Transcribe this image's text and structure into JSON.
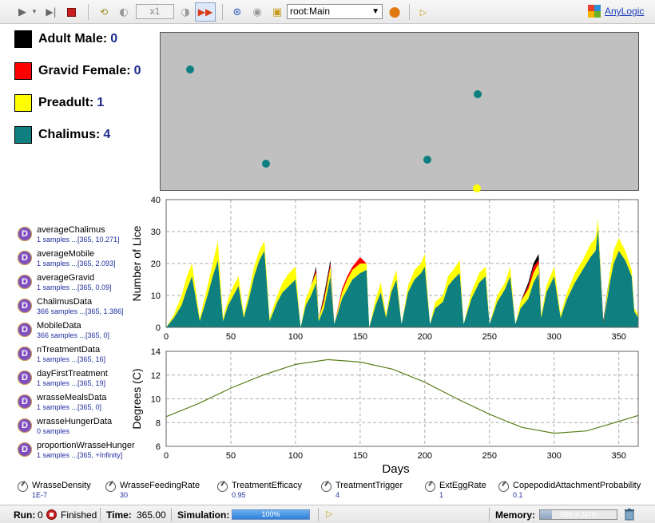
{
  "toolbar": {
    "speed": "x1",
    "experiment": "root:Main",
    "brand": "AnyLogic"
  },
  "legend": [
    {
      "label": "Adult Male:",
      "count": "0",
      "color": "#000000"
    },
    {
      "label": "Gravid Female:",
      "count": "0",
      "color": "#ff0000"
    },
    {
      "label": "Preadult:",
      "count": "1",
      "color": "#ffff00"
    },
    {
      "label": "Chalimus:",
      "count": "4",
      "color": "#0f7f7f"
    }
  ],
  "canvas": {
    "background": "#c0c0c0",
    "agents": [
      {
        "kind": "chalimus",
        "color": "#0f7f7f"
      },
      {
        "kind": "chalimus",
        "color": "#0f7f7f"
      },
      {
        "kind": "chalimus",
        "color": "#0f7f7f"
      },
      {
        "kind": "chalimus",
        "color": "#0f7f7f"
      },
      {
        "kind": "preadult",
        "color": "#ffff00"
      }
    ]
  },
  "datasets": [
    {
      "name": "averageChalimus",
      "sub": "1 samples ...[365, 10.271]"
    },
    {
      "name": "averageMobile",
      "sub": "1 samples ...[365, 2.093]"
    },
    {
      "name": "averageGravid",
      "sub": "1 samples ...[365, 0.09]"
    },
    {
      "name": "ChalimusData",
      "sub": "366 samples ...[365, 1.386]"
    },
    {
      "name": "MobileData",
      "sub": "366 samples ...[365, 0]"
    },
    {
      "name": "nTreatmentData",
      "sub": "1 samples ...[365, 16]"
    },
    {
      "name": "dayFirstTreatment",
      "sub": "1 samples ...[365, 19]"
    },
    {
      "name": "wrasseMealsData",
      "sub": "1 samples ...[365, 0]"
    },
    {
      "name": "wrasseHungerData",
      "sub": "0 samples"
    },
    {
      "name": "proportionWrasseHunger",
      "sub": "1 samples ...[365, +Infinity]"
    }
  ],
  "dataset_icon_letter": "D",
  "chart_data": [
    {
      "type": "area",
      "title": "",
      "xlabel": "",
      "ylabel": "Number of Lice",
      "xlim": [
        0,
        365
      ],
      "ylim": [
        0,
        40
      ],
      "xticks": [
        "0",
        "50",
        "100",
        "150",
        "200",
        "250",
        "300",
        "350"
      ],
      "yticks": [
        "0",
        "10",
        "20",
        "30",
        "40"
      ],
      "grid": true,
      "stacked": true,
      "series": [
        {
          "color": "#0f7f7f",
          "x": [
            0,
            6,
            12,
            16,
            20,
            26,
            32,
            36,
            40,
            44,
            48,
            52,
            56,
            60,
            64,
            68,
            72,
            76,
            80,
            86,
            90,
            95,
            100,
            104,
            108,
            112,
            116,
            118,
            122,
            127,
            130,
            136,
            140,
            144,
            150,
            155,
            157,
            162,
            166,
            170,
            174,
            178,
            182,
            187,
            192,
            197,
            200,
            204,
            208,
            214,
            218,
            222,
            227,
            230,
            236,
            242,
            247,
            250,
            256,
            262,
            266,
            270,
            274,
            280,
            284,
            288,
            290,
            294,
            300,
            305,
            310,
            316,
            322,
            328,
            332,
            334,
            338,
            343,
            346,
            350,
            355,
            360,
            362,
            365
          ],
          "values": [
            0,
            3,
            7,
            12,
            16,
            2,
            10,
            16,
            21,
            2,
            7,
            10,
            13,
            3,
            9,
            16,
            21,
            24,
            2,
            8,
            11,
            13,
            15,
            0,
            7,
            10,
            14,
            2,
            6,
            16,
            1,
            9,
            12,
            15,
            17,
            18,
            0,
            7,
            11,
            3,
            11,
            15,
            1,
            11,
            15,
            17,
            19,
            1,
            6,
            8,
            13,
            15,
            17,
            1,
            9,
            14,
            16,
            1,
            8,
            12,
            16,
            1,
            6,
            9,
            14,
            17,
            3,
            11,
            16,
            3,
            9,
            14,
            18,
            22,
            24,
            31,
            1,
            14,
            20,
            24,
            21,
            16,
            5,
            3
          ]
        },
        {
          "color": "#ffff00",
          "x": [
            0,
            6,
            12,
            16,
            20,
            26,
            32,
            36,
            40,
            44,
            48,
            52,
            56,
            60,
            64,
            68,
            72,
            76,
            80,
            86,
            90,
            95,
            100,
            104,
            108,
            112,
            116,
            118,
            122,
            127,
            130,
            136,
            140,
            144,
            150,
            155,
            157,
            162,
            166,
            170,
            174,
            178,
            182,
            187,
            192,
            197,
            200,
            204,
            208,
            214,
            218,
            222,
            227,
            230,
            236,
            242,
            247,
            250,
            256,
            262,
            266,
            270,
            274,
            280,
            284,
            288,
            290,
            294,
            300,
            305,
            310,
            316,
            322,
            328,
            332,
            334,
            338,
            343,
            346,
            350,
            355,
            360,
            362,
            365
          ],
          "values": [
            0,
            1,
            3,
            4,
            4,
            1,
            3,
            4,
            6,
            1,
            2,
            3,
            3,
            1,
            2,
            3,
            3,
            3,
            1,
            2,
            3,
            4,
            4,
            0,
            2,
            3,
            3,
            1,
            2,
            3,
            0,
            2,
            3,
            3,
            3,
            2,
            0,
            2,
            3,
            1,
            2,
            3,
            0,
            2,
            3,
            3,
            4,
            0,
            2,
            2,
            3,
            3,
            4,
            0,
            2,
            3,
            3,
            0,
            2,
            2,
            3,
            0,
            2,
            3,
            3,
            3,
            1,
            2,
            3,
            1,
            2,
            3,
            3,
            4,
            4,
            3,
            0,
            3,
            4,
            4,
            3,
            2,
            1,
            1
          ]
        },
        {
          "color": "#ff0000",
          "x": [
            0,
            6,
            12,
            16,
            20,
            26,
            32,
            36,
            40,
            44,
            48,
            52,
            56,
            60,
            64,
            68,
            72,
            76,
            80,
            86,
            90,
            95,
            100,
            104,
            108,
            112,
            116,
            118,
            122,
            127,
            130,
            136,
            140,
            144,
            150,
            155,
            157,
            162,
            166,
            170,
            174,
            178,
            182,
            187,
            192,
            197,
            200,
            204,
            208,
            214,
            218,
            222,
            227,
            230,
            236,
            242,
            247,
            250,
            256,
            262,
            266,
            270,
            274,
            280,
            284,
            288,
            290,
            294,
            300,
            305,
            310,
            316,
            322,
            328,
            332,
            334,
            338,
            343,
            346,
            350,
            355,
            360,
            362,
            365
          ],
          "values": [
            0,
            0,
            0,
            0,
            0,
            0,
            0,
            0,
            0,
            0,
            0,
            0,
            0,
            0,
            0,
            0,
            0,
            0,
            0,
            0,
            0,
            0,
            0,
            0,
            0,
            0,
            1,
            0,
            1,
            1,
            0,
            1,
            1,
            1,
            2,
            0,
            0,
            0,
            0,
            0,
            0,
            0,
            0,
            0,
            0,
            0,
            0,
            0,
            0,
            0,
            0,
            0,
            0,
            0,
            0,
            0,
            0,
            0,
            0,
            0,
            0,
            0,
            0,
            1,
            2,
            1,
            0,
            0,
            0,
            0,
            0,
            0,
            0,
            0,
            0,
            0,
            0,
            0,
            0,
            0,
            0,
            0,
            0,
            0
          ]
        },
        {
          "color": "#000000",
          "x": [
            0,
            6,
            12,
            16,
            20,
            26,
            32,
            36,
            40,
            44,
            48,
            52,
            56,
            60,
            64,
            68,
            72,
            76,
            80,
            86,
            90,
            95,
            100,
            104,
            108,
            112,
            116,
            118,
            122,
            127,
            130,
            136,
            140,
            144,
            150,
            155,
            157,
            162,
            166,
            170,
            174,
            178,
            182,
            187,
            192,
            197,
            200,
            204,
            208,
            214,
            218,
            222,
            227,
            230,
            236,
            242,
            247,
            250,
            256,
            262,
            266,
            270,
            274,
            280,
            284,
            288,
            290,
            294,
            300,
            305,
            310,
            316,
            322,
            328,
            332,
            334,
            338,
            343,
            346,
            350,
            355,
            360,
            362,
            365
          ],
          "values": [
            0,
            0,
            0,
            0,
            0,
            0,
            0,
            0,
            0,
            0,
            0,
            0,
            0,
            0,
            0,
            0,
            0,
            0,
            0,
            0,
            0,
            0,
            0,
            0,
            0,
            0,
            1,
            0,
            1,
            1,
            0,
            0,
            0,
            0,
            0,
            0,
            0,
            0,
            0,
            0,
            0,
            0,
            0,
            0,
            0,
            0,
            0,
            0,
            0,
            0,
            0,
            0,
            0,
            0,
            0,
            0,
            0,
            0,
            0,
            0,
            0,
            0,
            0,
            1,
            1,
            2,
            0,
            0,
            0,
            0,
            0,
            0,
            0,
            0,
            0,
            0,
            1,
            0,
            0,
            0,
            0,
            0,
            0,
            0
          ]
        }
      ]
    },
    {
      "type": "line",
      "title": "",
      "xlabel": "Days",
      "ylabel": "Degrees (C)",
      "xlim": [
        0,
        365
      ],
      "ylim": [
        6,
        14
      ],
      "xticks": [
        "0",
        "50",
        "100",
        "150",
        "200",
        "250",
        "300",
        "350"
      ],
      "yticks": [
        "6",
        "8",
        "10",
        "12",
        "14"
      ],
      "grid": true,
      "series": [
        {
          "color": "#5a7f1a",
          "x": [
            0,
            25,
            50,
            75,
            100,
            125,
            150,
            175,
            200,
            225,
            250,
            275,
            300,
            325,
            350,
            365
          ],
          "values": [
            8.5,
            9.6,
            10.9,
            12.0,
            12.9,
            13.3,
            13.1,
            12.5,
            11.4,
            10.0,
            8.7,
            7.6,
            7.1,
            7.3,
            8.1,
            8.6
          ]
        }
      ]
    }
  ],
  "params": [
    {
      "name": "WrasseDensity",
      "value": "1E-7"
    },
    {
      "name": "WrasseFeedingRate",
      "value": "30"
    },
    {
      "name": "TreatmentEfficacy",
      "value": "0.95"
    },
    {
      "name": "TreatmentTrigger",
      "value": "4"
    },
    {
      "name": "ExtEggRate",
      "value": "1"
    },
    {
      "name": "CopepodidAttachmentProbability",
      "value": "0.1"
    }
  ],
  "status": {
    "run_label": "Run:",
    "run_value": "0",
    "state": "Finished",
    "time_label": "Time:",
    "time_value": "365.00",
    "sim_label": "Simulation:",
    "sim_percent_text": "100%",
    "sim_progress": 1.0,
    "mem_label": "Memory:",
    "mem_text": "39M of 247M",
    "mem_fraction": 0.16
  }
}
